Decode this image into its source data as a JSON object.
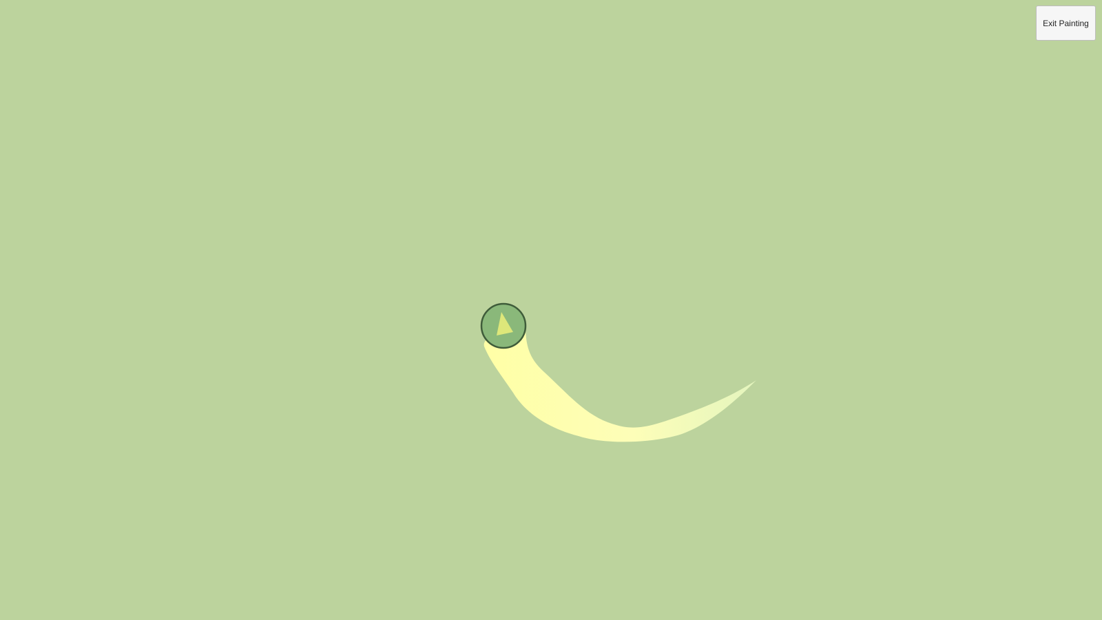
{
  "toolbar": {
    "exit_label": "Exit Painting"
  },
  "colors": {
    "background": "#bcd39d",
    "stroke_start": "#ffffa6",
    "stroke_end": "#e4f5be",
    "brush_fill": "#8ab87a",
    "brush_border": "#3f5c3a",
    "pointer_fill": "#dde77a"
  },
  "icons": {
    "brush_cursor": "brush-cursor-icon",
    "direction_pointer": "triangle-pointer-icon"
  }
}
